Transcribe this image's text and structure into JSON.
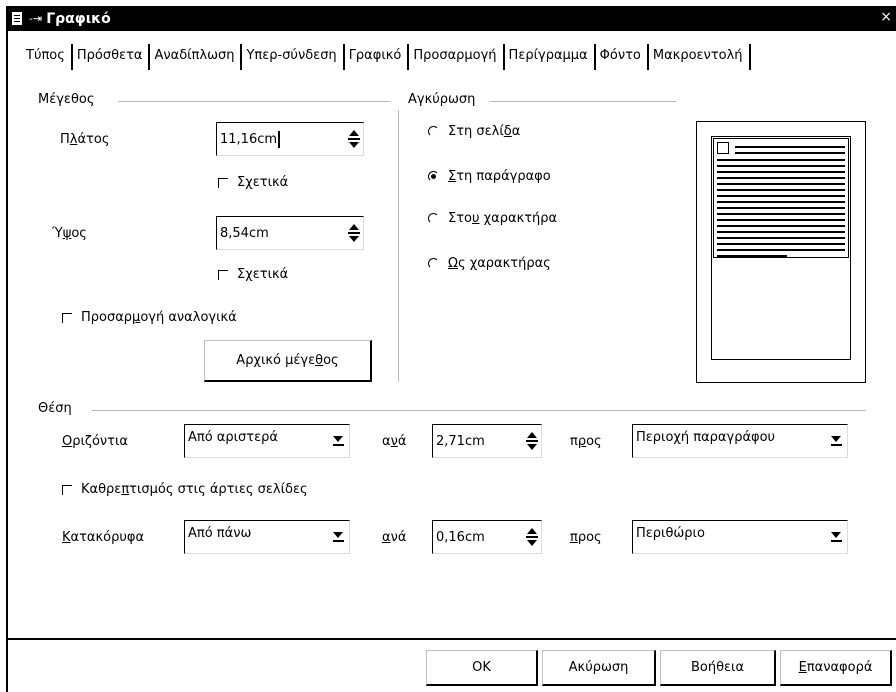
{
  "window": {
    "title": "Γραφικό",
    "close_glyph": "×"
  },
  "tabs": [
    {
      "label": "Τύπος",
      "active": true
    },
    {
      "label": "Πρόσθετα"
    },
    {
      "label": "Αναδίπλωση"
    },
    {
      "label": "Υπερ-σύνδεση"
    },
    {
      "label": "Γραφικό"
    },
    {
      "label": "Προσαρμογή"
    },
    {
      "label": "Περίγραμμα"
    },
    {
      "label": "Φόντο"
    },
    {
      "label": "Μακροεντολή"
    }
  ],
  "size": {
    "group_label": "Μέγεθος",
    "width_label_pre": "Π",
    "width_label_acc": "λ",
    "width_label_post": "άτος",
    "width_value": "11,16cm",
    "relative_label_pre": "Σ",
    "relative_label_acc": "χ",
    "relative_label_post": "ετικά",
    "height_label_pre": "Ύ",
    "height_label_acc": "ψ",
    "height_label_post": "ος",
    "height_value": "8,54cm",
    "relative2_label_pre": "Σ",
    "relative2_label_acc": "χ",
    "relative2_label_post": "ετικά",
    "keep_ratio_pre": "Προσαρ",
    "keep_ratio_acc": "μ",
    "keep_ratio_post": "ογή αναλογικά",
    "original_size_pre": "Αρχικό μέγε",
    "original_size_acc": "θ",
    "original_size_post": "ος"
  },
  "anchor": {
    "group_label": "Αγκύρωση",
    "options": [
      {
        "pre": "Στη σελί",
        "acc": "δ",
        "post": "α",
        "selected": false
      },
      {
        "pre": "",
        "acc": "Σ",
        "post": "τη παράγραφο",
        "selected": true
      },
      {
        "pre": "Στο",
        "acc": "υ",
        "post": " χαρακτήρα",
        "selected": false
      },
      {
        "pre": "",
        "acc": "Ω",
        "post": "ς χαρακτήρας",
        "selected": false
      }
    ]
  },
  "position": {
    "group_label": "Θέση",
    "horizontal_label_acc": "Ο",
    "horizontal_label_post": "ριζόντια",
    "horizontal_value": "Από αριστερά",
    "by_label_1_pre": "α",
    "by_label_1_acc": "ν",
    "by_label_1_post": "ά",
    "horizontal_offset": "2,71cm",
    "to_label_1_pre": "π",
    "to_label_1_acc": "ρ",
    "to_label_1_post": "ος",
    "horizontal_to": "Περιοχή παραγράφου",
    "mirror_pre": "Καθρε",
    "mirror_acc": "π",
    "mirror_post": "τισμός στις άρτιες σελίδες",
    "vertical_label_acc": "Κ",
    "vertical_label_post": "ατακόρυφα",
    "vertical_value": "Από πάνω",
    "by_label_2_acc": "α",
    "by_label_2_post": "νά",
    "vertical_offset": "0,16cm",
    "to_label_2_acc": "π",
    "to_label_2_post": "ρος",
    "vertical_to": "Περιθώριο"
  },
  "buttons": {
    "ok": "OK",
    "cancel": "Ακύρωση",
    "help": "Βοήθεια",
    "reset_acc": "Ε",
    "reset_post": "παναφορά"
  }
}
